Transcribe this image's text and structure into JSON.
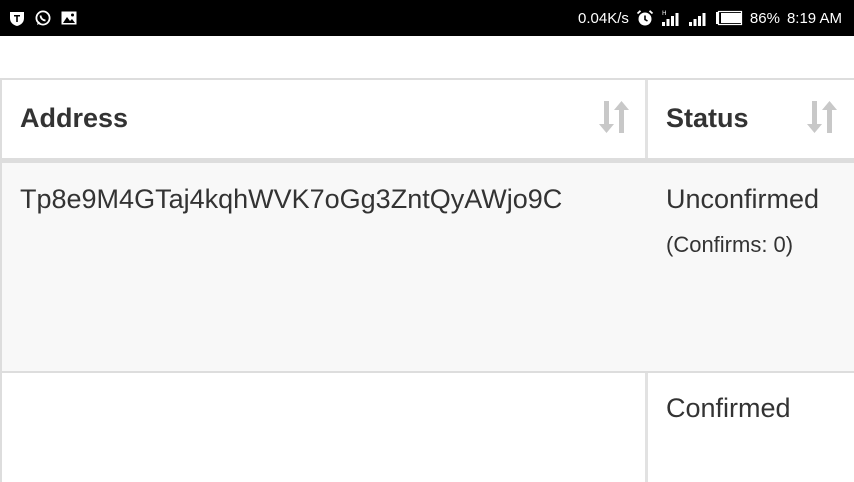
{
  "status_bar": {
    "network_speed": "0.04K/s",
    "battery_percent": "86%",
    "time": "8:19 AM",
    "battery_level": 0.86,
    "left_icons": [
      "shield-icon",
      "whatsapp-icon",
      "image-icon"
    ],
    "right_icons": [
      "alarm-icon",
      "signal-icon",
      "signal-icon",
      "battery-icon"
    ]
  },
  "table": {
    "columns": [
      {
        "label": "Address",
        "sort_icon": "sort-icon"
      },
      {
        "label": "Status",
        "sort_icon": "sort-icon"
      }
    ],
    "rows": [
      {
        "address": "Tp8e9M4GTaj4kqhWVK7oGg3ZntQyAWjo9C",
        "status": "Unconfirmed",
        "detail": "(Confirms: 0)"
      },
      {
        "address": "",
        "status": "Confirmed",
        "detail": ""
      }
    ]
  },
  "colors": {
    "status_bar_bg": "#000000",
    "border": "#dddddd",
    "row_alt_bg": "#f8f8f8",
    "text": "#333333",
    "sort_icon": "#c8c8c8"
  }
}
